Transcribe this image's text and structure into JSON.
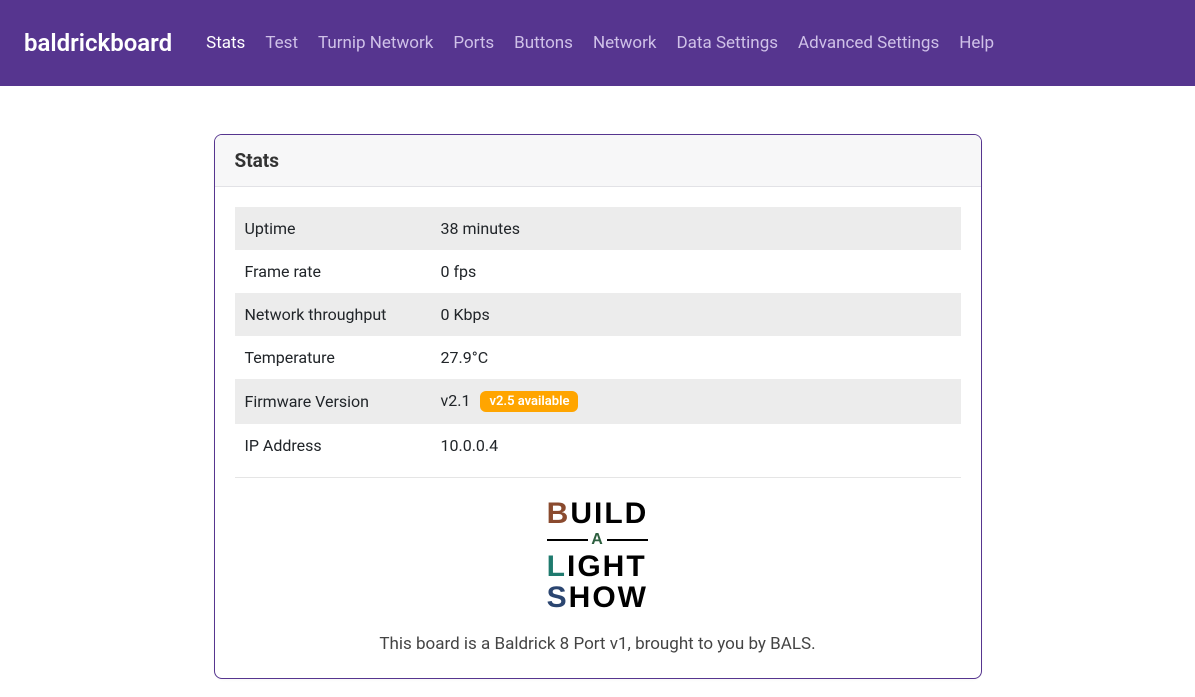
{
  "header": {
    "brand": "baldrickboard",
    "nav": [
      "Stats",
      "Test",
      "Turnip Network",
      "Ports",
      "Buttons",
      "Network",
      "Data Settings",
      "Advanced Settings",
      "Help"
    ]
  },
  "card": {
    "title": "Stats",
    "rows": [
      {
        "label": "Uptime",
        "value": "38 minutes"
      },
      {
        "label": "Frame rate",
        "value": "0 fps"
      },
      {
        "label": "Network throughput",
        "value": "0 Kbps"
      },
      {
        "label": "Temperature",
        "value": "27.9°C"
      },
      {
        "label": "Firmware Version",
        "value": "v2.1",
        "badge": "v2.5 available"
      },
      {
        "label": "IP Address",
        "value": "10.0.0.4"
      }
    ],
    "logo": {
      "line1": "BUILD",
      "a": "A",
      "line2": "LIGHT",
      "line3": "SHOW"
    },
    "footer_text": "This board is a Baldrick 8 Port v1, brought to you by BALS."
  }
}
